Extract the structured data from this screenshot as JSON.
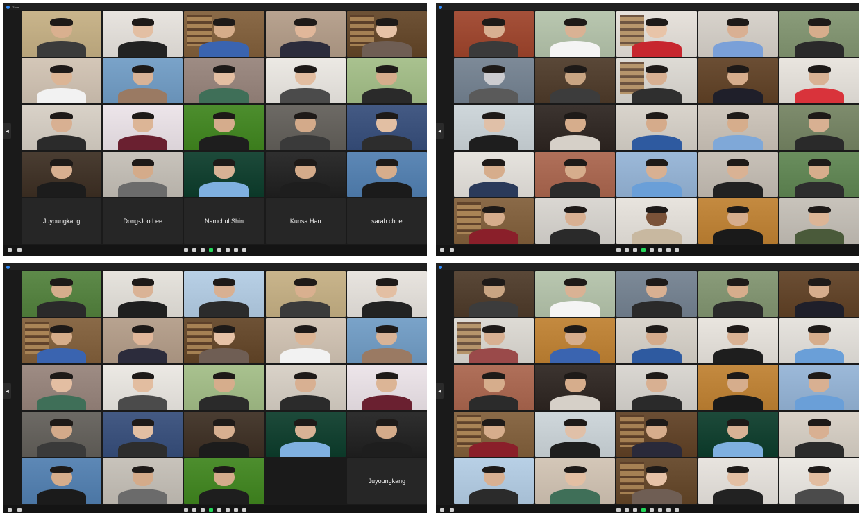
{
  "windows": [
    {
      "id": "w0",
      "title": "Zoom",
      "tiles": [
        {
          "label": "",
          "wall": "#c9b58c",
          "skin": "#d9b08f",
          "shirt": "#3b3b3b"
        },
        {
          "label": "",
          "wall": "#e8e4df",
          "skin": "#e3bfa3",
          "shirt": "#222222"
        },
        {
          "label": "",
          "wall": "#8a6a48",
          "skin": "#d6ad8a",
          "shirt": "#3a64b0",
          "shelf": true
        },
        {
          "label": "",
          "wall": "#b8a390",
          "skin": "#e0b79a",
          "shirt": "#2c2c3c"
        },
        {
          "label": "",
          "wall": "#6e5236",
          "skin": "#e6c2a6",
          "shirt": "#6f5e54",
          "shelf": true
        },
        {
          "label": "",
          "wall": "#d4c7b8",
          "skin": "#dcb595",
          "shirt": "#f2f2f2"
        },
        {
          "label": "",
          "wall": "#7aa3c9",
          "skin": "#d8b397",
          "shirt": "#9a7a63"
        },
        {
          "label": "",
          "wall": "#9e8c84",
          "skin": "#e3bea2",
          "shirt": "#3f6f58"
        },
        {
          "label": "",
          "wall": "#ece9e4",
          "skin": "#e2bda0",
          "shirt": "#4b4b4b"
        },
        {
          "label": "",
          "wall": "#a9c28f",
          "skin": "#d6ad8c",
          "shirt": "#2a2a2a"
        },
        {
          "label": "",
          "wall": "#d9d2c8",
          "skin": "#d8b092",
          "shirt": "#2b2b2b"
        },
        {
          "label": "",
          "wall": "#ede5ea",
          "skin": "#dcb596",
          "shirt": "#6a2030"
        },
        {
          "label": "",
          "wall": "#4d8e2e",
          "skin": "#d5ac8c",
          "shirt": "#1e1e1e"
        },
        {
          "label": "",
          "wall": "#6d6a65",
          "skin": "#d3aa8a",
          "shirt": "#3a3a3a"
        },
        {
          "label": "",
          "wall": "#445a84",
          "skin": "#e2bfa3",
          "shirt": "#2d2d2d"
        },
        {
          "label": "",
          "wall": "#4a3d32",
          "skin": "#d7af90",
          "shirt": "#1c1c1c"
        },
        {
          "label": "",
          "wall": "#c8c3bb",
          "skin": "#d4ab8a",
          "shirt": "#6b6b6b"
        },
        {
          "label": "",
          "wall": "#1d4a3a",
          "skin": "#d8b295",
          "shirt": "#7fb0e0"
        },
        {
          "label": "",
          "wall": "#2f2f2f",
          "skin": "#d4ab8a",
          "shirt": "#1e1e1e"
        },
        {
          "label": "",
          "wall": "#5d88b6",
          "skin": "#d6ad8c",
          "shirt": "#1b1b1b"
        },
        {
          "text": "Juyoungkang"
        },
        {
          "text": "Dong-Joo Lee"
        },
        {
          "text": "Namchul Shin"
        },
        {
          "text": "Kunsa Han"
        },
        {
          "text": "sarah choe"
        }
      ]
    },
    {
      "id": "w1",
      "title": "",
      "tiles": [
        {
          "label": "",
          "wall": "#a5513a",
          "skin": "#d8b092",
          "shirt": "#3a3a3a"
        },
        {
          "label": "",
          "wall": "#b9c7b0",
          "skin": "#d9b294",
          "shirt": "#f4f4f4"
        },
        {
          "label": "",
          "wall": "#e7e2dc",
          "skin": "#e8c4a8",
          "shirt": "#c7262e",
          "shelf": true
        },
        {
          "label": "",
          "wall": "#d8d3cc",
          "skin": "#d9b093",
          "shirt": "#7aa0d8"
        },
        {
          "label": "",
          "wall": "#8a9c7a",
          "skin": "#d6ad8c",
          "shirt": "#2a2a2a"
        },
        {
          "label": "",
          "wall": "#7d8a98",
          "skin": "#ccccd0",
          "shirt": "#5a5a5a"
        },
        {
          "label": "",
          "wall": "#5a4838",
          "skin": "#c9a583",
          "shirt": "#3c3c3c"
        },
        {
          "label": "",
          "wall": "#dedbd5",
          "skin": "#d8b092",
          "shirt": "#2f2f2f",
          "shelf": true
        },
        {
          "label": "",
          "wall": "#6b4e34",
          "skin": "#d6ad8c",
          "shirt": "#1f1f2a"
        },
        {
          "label": "",
          "wall": "#e9e5df",
          "skin": "#d9b294",
          "shirt": "#d9333b"
        },
        {
          "label": "",
          "wall": "#cfd7db",
          "skin": "#e0c0a8",
          "shirt": "#1e1e1e"
        },
        {
          "label": "",
          "wall": "#3c3430",
          "skin": "#d6ad8c",
          "shirt": "#d6d0c8"
        },
        {
          "label": "",
          "wall": "#d9d4cc",
          "skin": "#d5ab8b",
          "shirt": "#2e5aa0"
        },
        {
          "label": "",
          "wall": "#cfc7bd",
          "skin": "#d6ad8c",
          "shirt": "#7fa8d8"
        },
        {
          "label": "",
          "wall": "#7e8c6d",
          "skin": "#d8b092",
          "shirt": "#2a2a2a"
        },
        {
          "label": "",
          "wall": "#e6e3de",
          "skin": "#d6ad8c",
          "shirt": "#2a3a5a"
        },
        {
          "label": "",
          "wall": "#b0705a",
          "skin": "#d6ad8c",
          "shirt": "#2b2b2b"
        },
        {
          "label": "",
          "wall": "#9cb9d9",
          "skin": "#d8b092",
          "shirt": "#6a9fd8"
        },
        {
          "label": "",
          "wall": "#c8c1b8",
          "skin": "#d9b294",
          "shirt": "#222222"
        },
        {
          "label": "",
          "wall": "#6a8e5e",
          "skin": "#d6ad8c",
          "shirt": "#2d2d2d"
        },
        {
          "label": "",
          "wall": "#8a6a48",
          "skin": "#d6ad8c",
          "shirt": "#8a1f2a",
          "shelf": true
        },
        {
          "label": "",
          "wall": "#dad7d2",
          "skin": "#d8b092",
          "shirt": "#2a2a2a"
        },
        {
          "label": "",
          "wall": "#e8e4de",
          "skin": "#7a5238",
          "shirt": "#c8b8a0"
        },
        {
          "label": "",
          "wall": "#c48a40",
          "skin": "#d6ad8c",
          "shirt": "#1a1a1a"
        },
        {
          "label": "",
          "wall": "#c8c3bb",
          "skin": "#dcb596",
          "shirt": "#4a5a3a"
        }
      ]
    },
    {
      "id": "w2",
      "title": "",
      "tiles": [
        {
          "label": "",
          "wall": "#5e8a4a",
          "skin": "#d6ad8c",
          "shirt": "#2a2a2a"
        },
        {
          "label": "",
          "wall": "#e6e3dd",
          "skin": "#dab396",
          "shirt": "#1f1f1f"
        },
        {
          "label": "",
          "wall": "#b8d0e6",
          "skin": "#d8b092",
          "shirt": "#2b2b2b"
        },
        {
          "label": "",
          "wall": "#c9b58c",
          "skin": "#d9b08f",
          "shirt": "#3b3b3b"
        },
        {
          "label": "",
          "wall": "#e8e4df",
          "skin": "#e3bfa3",
          "shirt": "#222222"
        },
        {
          "label": "",
          "wall": "#8a6a48",
          "skin": "#d6ad8a",
          "shirt": "#3a64b0",
          "shelf": true
        },
        {
          "label": "",
          "wall": "#b8a390",
          "skin": "#e0b79a",
          "shirt": "#2c2c3c"
        },
        {
          "label": "",
          "wall": "#6e5236",
          "skin": "#e6c2a6",
          "shirt": "#6f5e54",
          "shelf": true
        },
        {
          "label": "",
          "wall": "#d4c7b8",
          "skin": "#dcb595",
          "shirt": "#f2f2f2"
        },
        {
          "label": "",
          "wall": "#7aa3c9",
          "skin": "#d8b397",
          "shirt": "#9a7a63"
        },
        {
          "label": "",
          "wall": "#9e8c84",
          "skin": "#e3bea2",
          "shirt": "#3f6f58"
        },
        {
          "label": "",
          "wall": "#ece9e4",
          "skin": "#e2bda0",
          "shirt": "#4b4b4b"
        },
        {
          "label": "",
          "wall": "#a9c28f",
          "skin": "#d6ad8c",
          "shirt": "#2a2a2a"
        },
        {
          "label": "",
          "wall": "#d9d2c8",
          "skin": "#d8b092",
          "shirt": "#2b2b2b"
        },
        {
          "label": "",
          "wall": "#ede5ea",
          "skin": "#dcb596",
          "shirt": "#6a2030"
        },
        {
          "label": "",
          "wall": "#6d6a65",
          "skin": "#d3aa8a",
          "shirt": "#3a3a3a"
        },
        {
          "label": "",
          "wall": "#445a84",
          "skin": "#e2bfa3",
          "shirt": "#2d2d2d"
        },
        {
          "label": "",
          "wall": "#4a3d32",
          "skin": "#d7af90",
          "shirt": "#1c1c1c"
        },
        {
          "label": "",
          "wall": "#1d4a3a",
          "skin": "#d8b295",
          "shirt": "#7fb0e0"
        },
        {
          "label": "",
          "wall": "#2f2f2f",
          "skin": "#d4ab8a",
          "shirt": "#1e1e1e"
        },
        {
          "label": "",
          "wall": "#5d88b6",
          "skin": "#d6ad8c",
          "shirt": "#1b1b1b"
        },
        {
          "label": "",
          "wall": "#c8c3bb",
          "skin": "#d4ab8a",
          "shirt": "#6b6b6b"
        },
        {
          "label": "",
          "wall": "#4d8e2e",
          "skin": "#d5ac8c",
          "shirt": "#1e1e1e"
        },
        {
          "empty": true
        },
        {
          "text": "Juyoungkang"
        }
      ]
    },
    {
      "id": "w3",
      "title": "",
      "tiles": [
        {
          "label": "",
          "wall": "#5a4838",
          "skin": "#c9a583",
          "shirt": "#3c3c3c"
        },
        {
          "label": "",
          "wall": "#b9c7b0",
          "skin": "#d9b294",
          "shirt": "#f4f4f4"
        },
        {
          "label": "",
          "wall": "#7d8a98",
          "skin": "#d8b092",
          "shirt": "#2a2a2a"
        },
        {
          "label": "",
          "wall": "#8a9c7a",
          "skin": "#d6ad8c",
          "shirt": "#2a2a2a"
        },
        {
          "label": "",
          "wall": "#6b4e34",
          "skin": "#d6ad8c",
          "shirt": "#1f1f2a"
        },
        {
          "label": "",
          "wall": "#dedbd5",
          "skin": "#d8b092",
          "shirt": "#9a4a4a",
          "shelf": true
        },
        {
          "label": "",
          "wall": "#c48a40",
          "skin": "#d6ad8c",
          "shirt": "#3a64b0"
        },
        {
          "label": "",
          "wall": "#d9d4cc",
          "skin": "#d5ab8b",
          "shirt": "#2e5aa0"
        },
        {
          "label": "",
          "wall": "#e9e5df",
          "skin": "#d9b294",
          "shirt": "#1e1e1e"
        },
        {
          "label": "",
          "wall": "#e6e3de",
          "skin": "#d6ad8c",
          "shirt": "#6a9fd8"
        },
        {
          "label": "",
          "wall": "#b0705a",
          "skin": "#d6ad8c",
          "shirt": "#2b2b2b"
        },
        {
          "label": "",
          "wall": "#3c3430",
          "skin": "#d6ad8c",
          "shirt": "#d6d0c8"
        },
        {
          "label": "",
          "wall": "#dad7d2",
          "skin": "#d8b092",
          "shirt": "#2a2a2a"
        },
        {
          "label": "",
          "wall": "#c48a40",
          "skin": "#d6ad8c",
          "shirt": "#1a1a1a"
        },
        {
          "label": "",
          "wall": "#9cb9d9",
          "skin": "#d8b092",
          "shirt": "#6a9fd8"
        },
        {
          "label": "",
          "wall": "#8a6a48",
          "skin": "#d6ad8c",
          "shirt": "#8a1f2a",
          "shelf": true
        },
        {
          "label": "",
          "wall": "#cfd7db",
          "skin": "#e0c0a8",
          "shirt": "#1e1e1e"
        },
        {
          "label": "",
          "wall": "#6b4e34",
          "skin": "#d6ad8c",
          "shirt": "#2a2a3a",
          "shelf": true
        },
        {
          "label": "",
          "wall": "#1d4a3a",
          "skin": "#d8b295",
          "shirt": "#7fb0e0"
        },
        {
          "label": "",
          "wall": "#d9d2c8",
          "skin": "#d8b092",
          "shirt": "#2b2b2b"
        },
        {
          "label": "",
          "wall": "#b8d0e6",
          "skin": "#d8b092",
          "shirt": "#2b2b2b"
        },
        {
          "label": "",
          "wall": "#d4c7b8",
          "skin": "#e3bfa3",
          "shirt": "#3f6f58"
        },
        {
          "label": "",
          "wall": "#6e5236",
          "skin": "#e6c2a6",
          "shirt": "#6f5e54",
          "shelf": true
        },
        {
          "label": "",
          "wall": "#e8e4df",
          "skin": "#e3bfa3",
          "shirt": "#222222"
        },
        {
          "label": "",
          "wall": "#ece9e4",
          "skin": "#e2bda0",
          "shirt": "#4b4b4b"
        }
      ]
    }
  ],
  "toolbar": {
    "left": [
      {
        "icon": "microphone-icon",
        "label": ""
      },
      {
        "icon": "camera-icon",
        "label": ""
      }
    ],
    "center": [
      {
        "icon": "security-icon",
        "label": ""
      },
      {
        "icon": "participants-icon",
        "label": ""
      },
      {
        "icon": "chat-icon",
        "label": ""
      },
      {
        "icon": "share-screen-icon",
        "label": "",
        "accent": "#23d959"
      },
      {
        "icon": "record-icon",
        "label": ""
      },
      {
        "icon": "reactions-icon",
        "label": ""
      },
      {
        "icon": "apps-icon",
        "label": ""
      },
      {
        "icon": "whiteboard-icon",
        "label": ""
      }
    ]
  }
}
